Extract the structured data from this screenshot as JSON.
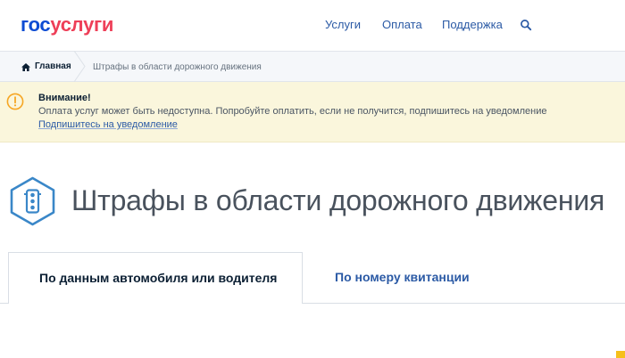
{
  "header": {
    "logo": {
      "part1": "гос",
      "part2": "услуги"
    },
    "nav": [
      {
        "label": "Услуги"
      },
      {
        "label": "Оплата"
      },
      {
        "label": "Поддержка"
      }
    ],
    "search_icon": "search-icon"
  },
  "breadcrumbs": {
    "home_label": "Главная",
    "current": "Штрафы в области дорожного движения"
  },
  "alert": {
    "title": "Внимание!",
    "text": "Оплата услуг может быть недоступна. Попробуйте оплатить, если не получится, подпишитесь на уведомление",
    "link": "Подпишитесь на уведомление"
  },
  "page": {
    "title": "Штрафы в области дорожного движения",
    "icon": "traffic-light-icon"
  },
  "tabs": [
    {
      "label": "По данным автомобиля или водителя",
      "active": true
    },
    {
      "label": "По номеру квитанции",
      "active": false
    }
  ],
  "colors": {
    "brand_blue": "#0d4cd3",
    "brand_red": "#ee3f58",
    "link_blue": "#2b5aa5",
    "alert_bg": "#faf6dc",
    "alert_icon": "#f6a623"
  }
}
